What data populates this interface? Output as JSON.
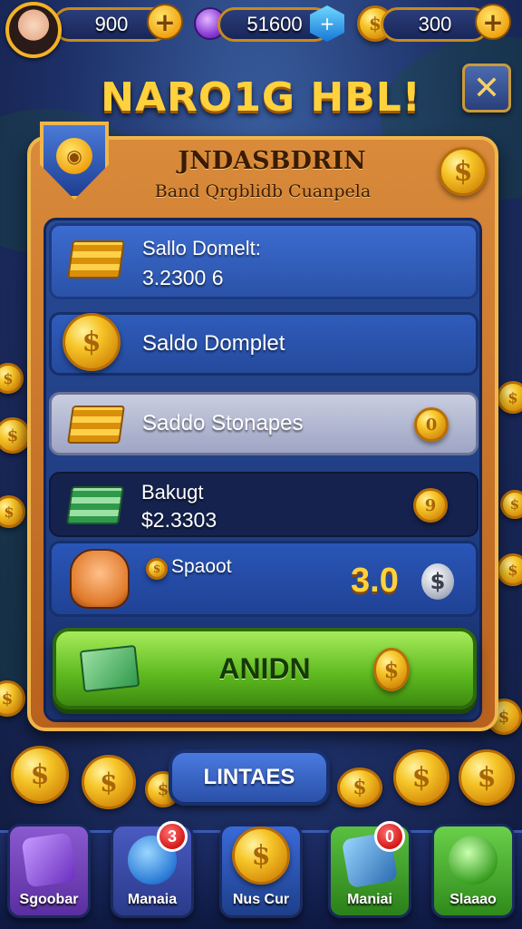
{
  "colors": {
    "gold": "#f6c528",
    "panel_orange": "#d98a3a",
    "panel_blue": "#274a94",
    "button_green": "#5cb81e"
  },
  "topbar": {
    "coins_value": "900",
    "gems_value": "51600",
    "gold_value": "300",
    "plus_icon": "+"
  },
  "header": {
    "title": "NARO1G HBL!",
    "close_icon": "✕"
  },
  "panel": {
    "title": "JNDASBDRIN",
    "subtitle": "Band Qrgblidb Cuanpela",
    "coin_symbol": "$"
  },
  "rows": [
    {
      "label": "Sallo Domelt:",
      "value": "3.2300 6"
    },
    {
      "label": "Saldo Domplet"
    },
    {
      "label": "Saddo Stonapes",
      "badge": "0"
    },
    {
      "label": "Bakugt",
      "value": "$2.3303",
      "badge": "9"
    },
    {
      "label": "Spaoot",
      "amount": "3.0",
      "amount_icon": "$"
    }
  ],
  "main_button": {
    "label": "ANIDN",
    "icon": "$"
  },
  "secondary_button": {
    "label": "LINTAES"
  },
  "nav": [
    {
      "label": "Sgoobar",
      "badge": ""
    },
    {
      "label": "Manaia",
      "badge": "3"
    },
    {
      "label": "Nus Cur",
      "badge": ""
    },
    {
      "label": "Maniai",
      "badge": "0"
    },
    {
      "label": "Slaaao",
      "badge": ""
    }
  ]
}
